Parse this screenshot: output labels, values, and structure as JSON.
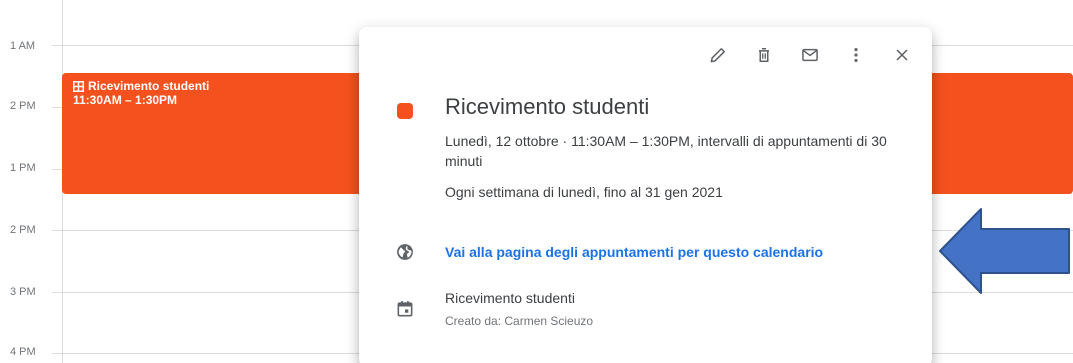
{
  "time_labels": [
    "1 AM",
    "2 PM",
    "1 PM",
    "2 PM",
    "3 PM",
    "4 PM"
  ],
  "event": {
    "title": "Ricevimento studenti",
    "time": "11:30AM – 1:30PM",
    "color": "#f4511e",
    "icon": "grid-icon"
  },
  "popup": {
    "toolbar": {
      "edit_icon": "pencil-icon",
      "delete_icon": "trash-icon",
      "email_icon": "mail-icon",
      "options_icon": "more-vert-icon",
      "close_icon": "close-icon"
    },
    "title": "Ricevimento studenti",
    "when": "Lunedì, 12 ottobre  ·  11:30AM – 1:30PM, intervalli di appuntamenti di 30 minuti",
    "recurrence": "Ogni settimana di lunedì, fino al 31 gen 2021",
    "appointment_link": "Vai alla pagina degli appuntamenti per questo calendario",
    "calendar_name": "Ricevimento studenti",
    "created_by": "Creato da: Carmen Scieuzo"
  },
  "colors": {
    "event": "#f4511e",
    "link": "#1a73e8",
    "annotation_arrow": "#4472c4"
  }
}
